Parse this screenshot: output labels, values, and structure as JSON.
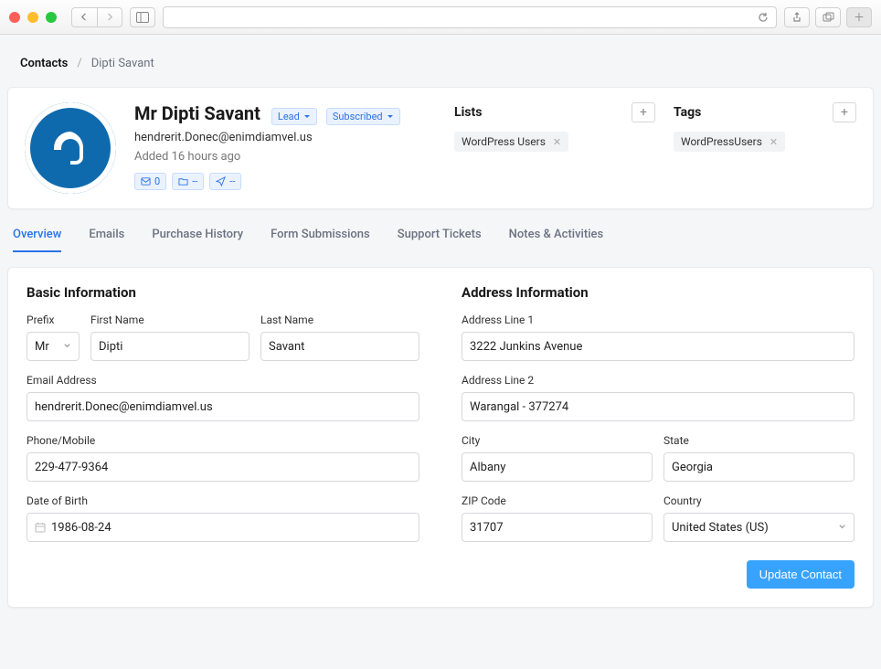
{
  "breadcrumb": {
    "root": "Contacts",
    "current": "Dipti Savant"
  },
  "contact": {
    "display_name": "Mr Dipti Savant",
    "status_pill": "Lead",
    "subscription_pill": "Subscribed",
    "email": "hendrerit.Donec@enimdiamvel.us",
    "added_line": "Added 16 hours ago",
    "stats": {
      "emails": "0",
      "folders": "--",
      "sends": "--"
    }
  },
  "lists": {
    "heading": "Lists",
    "items": [
      "WordPress Users"
    ]
  },
  "tags": {
    "heading": "Tags",
    "items": [
      "WordPressUsers"
    ]
  },
  "tabs": [
    "Overview",
    "Emails",
    "Purchase History",
    "Form Submissions",
    "Support Tickets",
    "Notes & Activities"
  ],
  "active_tab": "Overview",
  "basic": {
    "heading": "Basic Information",
    "labels": {
      "prefix": "Prefix",
      "first_name": "First Name",
      "last_name": "Last Name",
      "email": "Email Address",
      "phone": "Phone/Mobile",
      "dob": "Date of Birth"
    },
    "values": {
      "prefix": "Mr",
      "first_name": "Dipti",
      "last_name": "Savant",
      "email": "hendrerit.Donec@enimdiamvel.us",
      "phone": "229-477-9364",
      "dob": "1986-08-24"
    }
  },
  "address": {
    "heading": "Address Information",
    "labels": {
      "line1": "Address Line 1",
      "line2": "Address Line 2",
      "city": "City",
      "state": "State",
      "zip": "ZIP Code",
      "country": "Country"
    },
    "values": {
      "line1": "3222  Junkins Avenue",
      "line2": "Warangal - 377274",
      "city": "Albany",
      "state": "Georgia",
      "zip": "31707",
      "country": "United States (US)"
    }
  },
  "buttons": {
    "update": "Update Contact"
  }
}
